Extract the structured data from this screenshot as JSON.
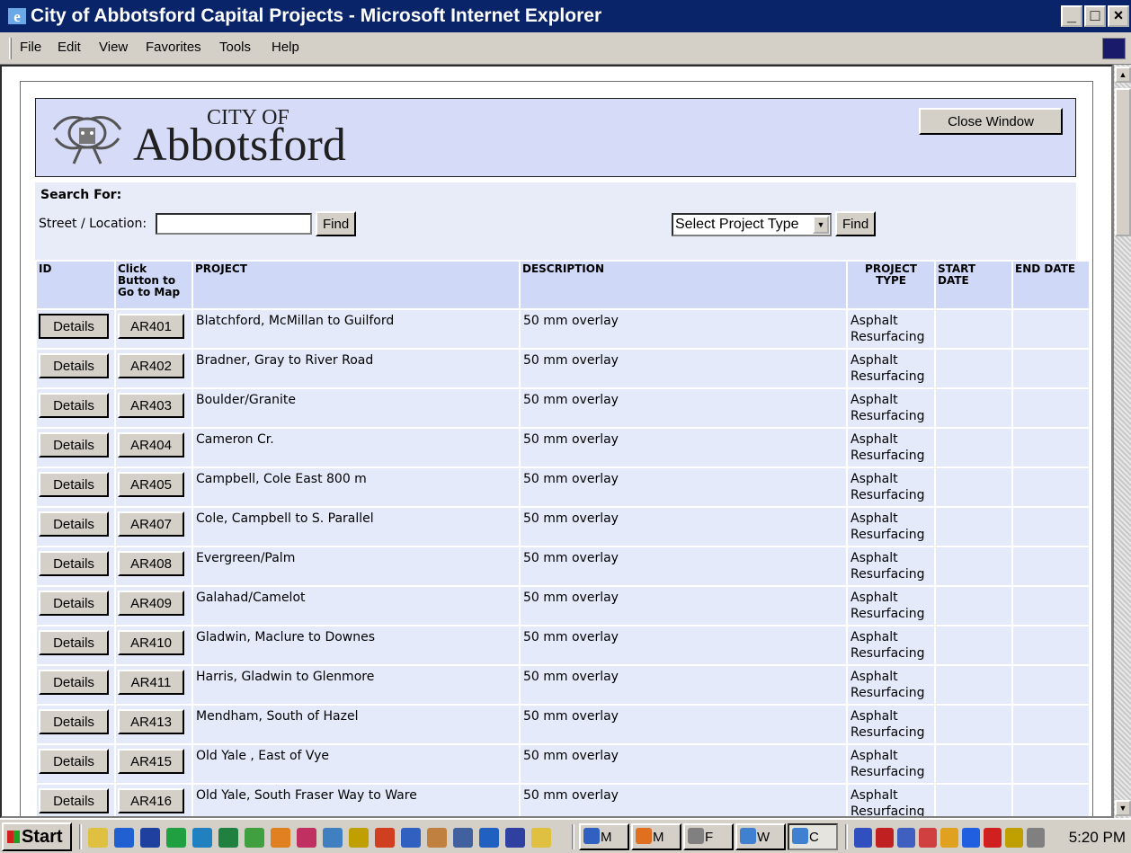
{
  "window": {
    "title": "City of Abbotsford Capital Projects - Microsoft Internet Explorer",
    "min": "_",
    "max": "□",
    "close": "×"
  },
  "menu": [
    "File",
    "Edit",
    "View",
    "Favorites",
    "Tools",
    "Help"
  ],
  "header": {
    "logo_city": "CITY OF",
    "logo_name": "Abbotsford",
    "close_label": "Close Window"
  },
  "search": {
    "title": "Search For:",
    "street_label": "Street / Location:",
    "street_value": "",
    "find_label": "Find",
    "project_type_selected": "Select Project Type",
    "find2_label": "Find"
  },
  "table": {
    "headers": {
      "id": "ID",
      "map": "Click Button to Go to Map",
      "project": "PROJECT",
      "description": "DESCRIPTION",
      "project_type": "PROJECT TYPE",
      "start_date": "START DATE",
      "end_date": "END DATE"
    },
    "details_label": "Details",
    "rows": [
      {
        "id": "AR401",
        "project": "Blatchford, McMillan to Guilford",
        "description": "50 mm overlay",
        "type": "Asphalt Resurfacing"
      },
      {
        "id": "AR402",
        "project": "Bradner, Gray to River Road",
        "description": "50 mm overlay",
        "type": "Asphalt Resurfacing"
      },
      {
        "id": "AR403",
        "project": "Boulder/Granite",
        "description": "50 mm overlay",
        "type": "Asphalt Resurfacing"
      },
      {
        "id": "AR404",
        "project": "Cameron Cr.",
        "description": "50 mm overlay",
        "type": "Asphalt Resurfacing"
      },
      {
        "id": "AR405",
        "project": "Campbell, Cole East 800 m",
        "description": "50 mm overlay",
        "type": "Asphalt Resurfacing"
      },
      {
        "id": "AR407",
        "project": "Cole, Campbell to S. Parallel",
        "description": "50 mm overlay",
        "type": "Asphalt Resurfacing"
      },
      {
        "id": "AR408",
        "project": "Evergreen/Palm",
        "description": "50 mm overlay",
        "type": "Asphalt Resurfacing"
      },
      {
        "id": "AR409",
        "project": "Galahad/Camelot",
        "description": "50 mm overlay",
        "type": "Asphalt Resurfacing"
      },
      {
        "id": "AR410",
        "project": "Gladwin, Maclure to Downes",
        "description": "50 mm overlay",
        "type": "Asphalt Resurfacing"
      },
      {
        "id": "AR411",
        "project": "Harris, Gladwin to Glenmore",
        "description": "50 mm overlay",
        "type": "Asphalt Resurfacing"
      },
      {
        "id": "AR413",
        "project": "Mendham, South of Hazel",
        "description": "50 mm overlay",
        "type": "Asphalt Resurfacing"
      },
      {
        "id": "AR415",
        "project": "Old Yale , East of Vye",
        "description": "50 mm overlay",
        "type": "Asphalt Resurfacing"
      },
      {
        "id": "AR416",
        "project": "Old Yale, South Fraser Way to Ware",
        "description": "50 mm overlay",
        "type": "Asphalt Resurfacing"
      }
    ]
  },
  "taskbar": {
    "start_label": "Start",
    "tasks": [
      "M",
      "M",
      "F",
      "W",
      "C"
    ],
    "clock": "5:20 PM"
  },
  "colors": {
    "titlebar": "#0a246a",
    "header_bg": "#d6dcf8",
    "row_bg": "#e4eafa",
    "th_bg": "#cfd8f6"
  }
}
